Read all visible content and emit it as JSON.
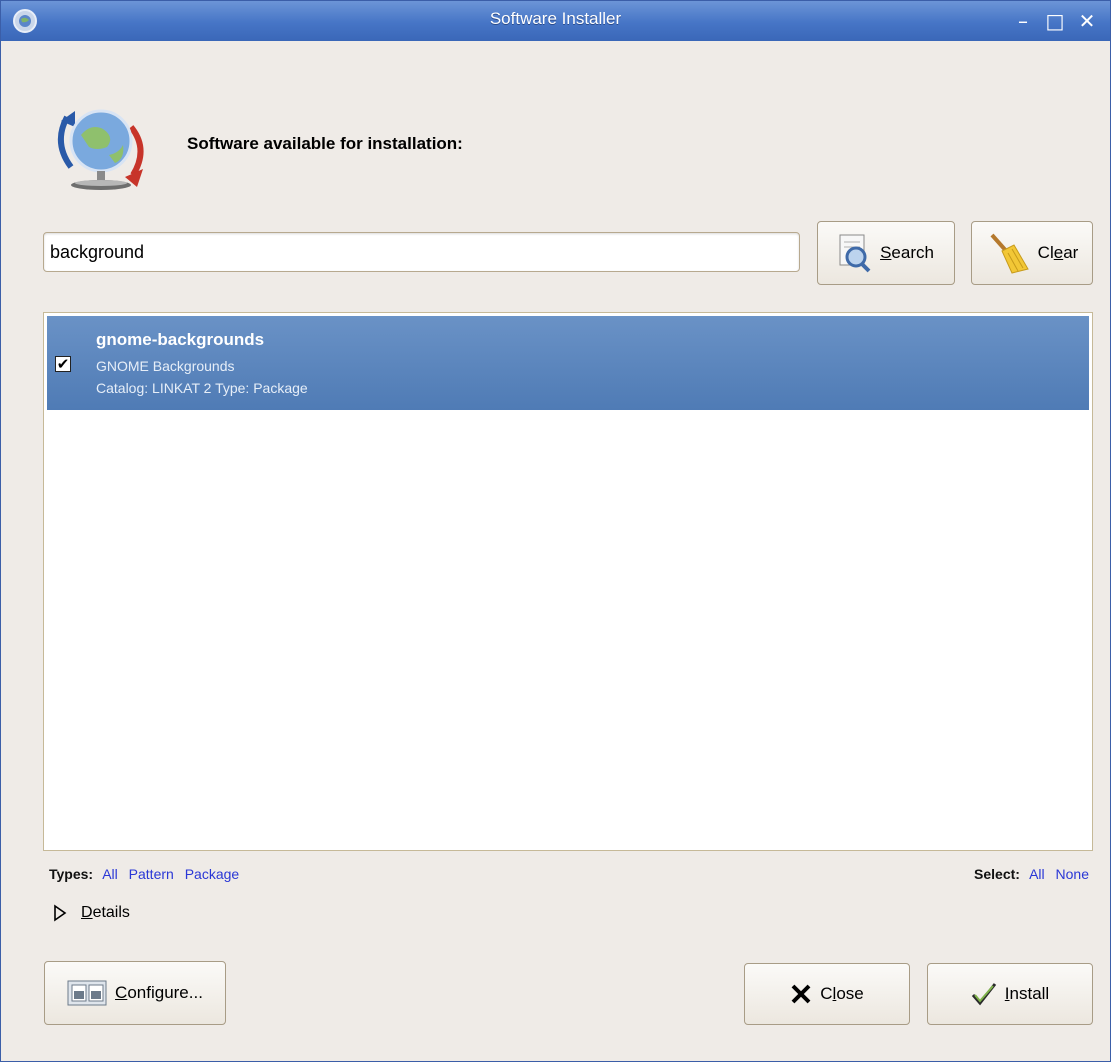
{
  "window": {
    "title": "Software Installer",
    "controls": {
      "minimize": "–",
      "maximize": "□",
      "close": "✕"
    }
  },
  "header": {
    "heading": "Software available for installation:"
  },
  "search": {
    "value": "background",
    "placeholder": ""
  },
  "buttons": {
    "search": {
      "pre": "",
      "mnemonic": "S",
      "post": "earch"
    },
    "clear": {
      "pre": "Cl",
      "mnemonic": "e",
      "post": "ar"
    },
    "configure": {
      "pre": "",
      "mnemonic": "C",
      "post": "onfigure..."
    },
    "close": {
      "pre": "C",
      "mnemonic": "l",
      "post": "ose"
    },
    "install": {
      "pre": "",
      "mnemonic": "I",
      "post": "nstall"
    }
  },
  "results": [
    {
      "name": "gnome-backgrounds",
      "description": "GNOME Backgrounds",
      "meta": "Catalog: LINKAT 2 Type: Package",
      "checked": true,
      "selected": true
    }
  ],
  "filters": {
    "types_label": "Types:",
    "types": [
      "All",
      "Pattern",
      "Package"
    ],
    "select_label": "Select:",
    "select": [
      "All",
      "None"
    ]
  },
  "details": {
    "pre": "",
    "mnemonic": "D",
    "post": "etails"
  },
  "colors": {
    "titlebar": "#4675c6",
    "selection": "#5a86bd",
    "link": "#2a37d6",
    "window_bg": "#efebe7"
  }
}
